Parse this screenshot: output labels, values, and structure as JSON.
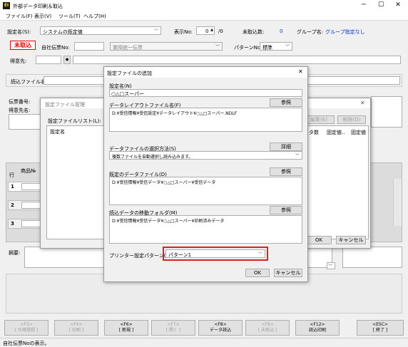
{
  "window": {
    "app_icon": "EI",
    "title": "外部データ印刷＆取込"
  },
  "menu": [
    "ファイル(F)",
    "表示(V)",
    "ツール(T)",
    "ヘルプ(H)"
  ],
  "header": {
    "setting_name_label": "設定名(S):",
    "setting_name_value": "システムの既定値",
    "display_no_label": "表示No:",
    "display_no_value": "0",
    "display_no_total": "/0",
    "unimported_label": "未取込数:",
    "unimported_value": "0",
    "group_label": "グループ名:",
    "group_value": "グループ指定なし"
  },
  "row2": {
    "badge": "未取込",
    "slip_no_label": "自社伝票No:",
    "slip_type_value": "業際統一伝票",
    "pattern_label": "パターンNo:",
    "pattern_value": "標準"
  },
  "row3": {
    "customer_label": "得意先:"
  },
  "read_file_label": "読込ファイル名:",
  "slip_no_label": "伝票番号:",
  "store_label": "得意先名:",
  "row_header": "行",
  "product_header": "商品№",
  "row_numbers": [
    "1",
    "2",
    "3"
  ],
  "remarks_label": "摘要:",
  "status_bar": "自社伝票Noの表示。",
  "fkeys": [
    {
      "key": "<F3>",
      "label": "[ 仕様登録 ]",
      "enabled": false
    },
    {
      "key": "<F4>",
      "label": "[ 印刷 ]",
      "enabled": false
    },
    {
      "key": "<F6>",
      "label": "[ 新規 ]",
      "enabled": true
    },
    {
      "key": "<F7>",
      "label": "[ 開く ]",
      "enabled": false
    },
    {
      "key": "<F8>",
      "label": "データ読込",
      "enabled": true
    },
    {
      "key": "<F9>",
      "label": "[ 未取込 ]",
      "enabled": false
    },
    {
      "key": "<F12>",
      "label": "読込印刷",
      "enabled": true
    },
    {
      "key": "<ESC>",
      "label": "[ 終了 ]",
      "enabled": true
    }
  ],
  "settings_manager": {
    "title": "設定ファイル管理",
    "list_label": "設定ファイルリスト(L):",
    "list_header": "設定名",
    "edit_button": "編集(E)",
    "delete_button": "削除(D)",
    "col_data": "ータ数",
    "col_fixed1": "固定値..",
    "col_fixed2": "固定値",
    "ok": "OK",
    "cancel": "キャンセル"
  },
  "add_dialog": {
    "title": "設定ファイルの追加",
    "name_label": "設定名(N)",
    "name_value": "○△□スーパー",
    "layout_label": "データレイアウトファイル名(F)",
    "layout_value": "D:¥受信情報¥受信設定¥データレイアウト¥○△□スーパー.NDLF",
    "browse": "参照",
    "select_method_label": "データファイルの選択方法(S)",
    "select_method_value": "複数ファイルを自動選択し読み込みます。",
    "detail": "詳細",
    "default_file_label": "既定のデータファイル(D)",
    "default_file_value": "D:¥受信情報¥受信データ¥○△□スーパー¥受信データ",
    "move_folder_label": "読込データの移動フォルダ(M)",
    "move_folder_value": "D:¥受信情報¥受信データ¥○△□スーパー¥印刷済みデータ",
    "printer_label": "プリンター設定パターン(P):",
    "printer_value": "パターン1",
    "ok": "OK",
    "cancel": "キャンセル",
    "highlight_color": "#e02020"
  }
}
